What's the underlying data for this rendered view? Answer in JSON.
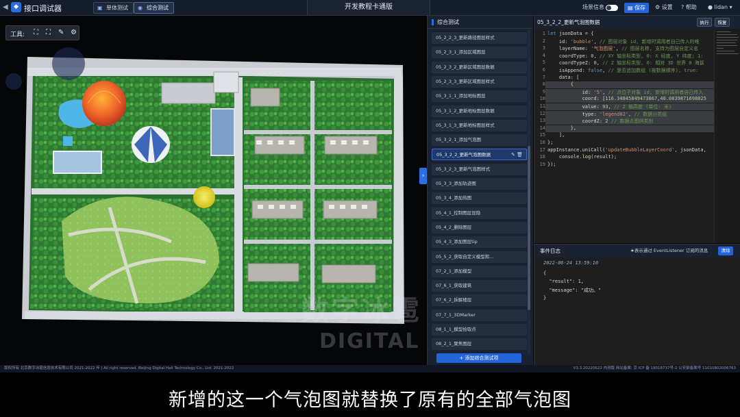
{
  "topbar": {
    "app_title": "接口调试器",
    "tab_single": "单体测试",
    "tab_integrated": "综合测试",
    "project_name": "开发教程卡通版",
    "scene_info_label": "场景信息",
    "save_label": "保存",
    "settings_label": "设置",
    "help_label": "帮助",
    "user_name": "lidan"
  },
  "map": {
    "tools_label": "工具:"
  },
  "test_list": {
    "title": "综合测试",
    "items": [
      "05_2_2_3_更新路径图层样式",
      "05_2_3_1_添加区域图层",
      "05_2_3_2_更新区域图层数据",
      "05_2_3_3_更新区域图层样式",
      "05_3_1_1_添加地标图层",
      "05_3_1_2_更新地标图层数据",
      "05_3_1_3_更新地标图层样式",
      "05_3_2_1_添加气泡图",
      "05_3_2_2_更新气泡图数据",
      "05_3_2_3_更新气泡图样式",
      "05_3_3_添加轨迹图",
      "05_3_4_添加热图",
      "05_4_1_控制图层显隐",
      "05_4_2_删除图层",
      "05_4_3_添加图层tip",
      "05_5_2_获取自定义模型和...",
      "07_2_1_添加模型",
      "07_6_1_获取建筑",
      "07_6_2_拆解楼层",
      "07_7_1_3DMarker",
      "08_1_1_模型拾取点",
      "08_2_1_聚焦图层"
    ],
    "selected_index": 8,
    "add_label": "+ 添加综合测试项"
  },
  "code_panel": {
    "title": "05_3_2_2_更新气泡图数据",
    "run_label": "执行",
    "restore_label": "恢复",
    "lines": [
      {
        "n": "1",
        "html": "<span class='kw'>let</span> jsonData = {"
      },
      {
        "n": "2",
        "html": "    id: <span class='str'>'bubble'</span>, <span class='cm'>// 图层对象 id, 新增时调用者自己传入的唯</span>"
      },
      {
        "n": "3",
        "html": "    layerName: <span class='str'>'气泡图层'</span>, <span class='cm'>// 图层名称, 支持为图层自定义名</span>"
      },
      {
        "n": "4",
        "html": "    coordType: <span class='num'>0</span>, <span class='cm'>// XY 轴坐标类型, 0: X 经度, Y 纬度; 1:</span>"
      },
      {
        "n": "5",
        "html": "    coordTypeZ: <span class='num'>0</span>, <span class='cm'>// Z 轴坐标类型, 0: 相对 3D 世界 0 海拔</span>"
      },
      {
        "n": "6",
        "html": "    isAppend: <span class='kw'>false</span>, <span class='cm'>// 是否追加数组 (按数据顺序), true:</span>"
      },
      {
        "n": "7",
        "html": "    data: ["
      },
      {
        "n": "8",
        "html": "        {"
      },
      {
        "n": "9",
        "html": "            id: <span class='str'>'5'</span>, <span class='cm'>// 点位子对象 id, 新增时调用者自己传入</span>"
      },
      {
        "n": "10",
        "html": "            coord: [<span class='num'>116.34845849473867</span>,<span class='num'>40.0839871698825</span>"
      },
      {
        "n": "11",
        "html": "            value: <span class='num'>93</span>, <span class='cm'>// Z 轴高度 (单位: 米)</span>"
      },
      {
        "n": "12",
        "html": "            type: <span class='str'>'legend02'</span>, <span class='cm'>// 数据分类组</span>"
      },
      {
        "n": "13",
        "html": "            coordZ: <span class='num'>2</span> <span class='cm'>// 数据点图例类别</span>"
      },
      {
        "n": "14",
        "html": "        },"
      },
      {
        "n": "15",
        "html": "    ],"
      },
      {
        "n": "16",
        "html": "};"
      },
      {
        "n": "17",
        "html": "appInstance.uniCall(<span class='str'>'updateBubbleLayerCoord'</span>, jsonData,"
      },
      {
        "n": "18",
        "html": "    console.<span class='fn'>log</span>(result);"
      },
      {
        "n": "19",
        "html": "});"
      }
    ],
    "highlight_from": 8,
    "highlight_to": 14
  },
  "event_log": {
    "title": "事件日志",
    "hint": "★表示通过 EventListener 订阅的消息",
    "clear_label": "清除",
    "timestamp": "2022-06-24 13:59:10",
    "lines": [
      "{",
      "  \"result\": 1,",
      "  \"message\": \"成功。\"",
      "}"
    ]
  },
  "footer": {
    "copyright": "版权所有 北京数字冰雹信息技术有限公司 2021-2022 年 | All right reserved. Beijing Digital Hail Technology Co., Ltd. 2021-2022",
    "version": "V3.3.20220622 内测版  网站备案: 京 ICP 备 19018737号-2 公安部备案号 11010802006763"
  },
  "watermark": {
    "line1": "数字冰雹",
    "line2": "DIGITAL HAIL"
  },
  "subtitle": "新增的这一个气泡图就替换了原有的全部气泡图",
  "colors": {
    "accent": "#2563d9",
    "panel": "#1a2130",
    "code_bg": "#1e1e1e"
  }
}
